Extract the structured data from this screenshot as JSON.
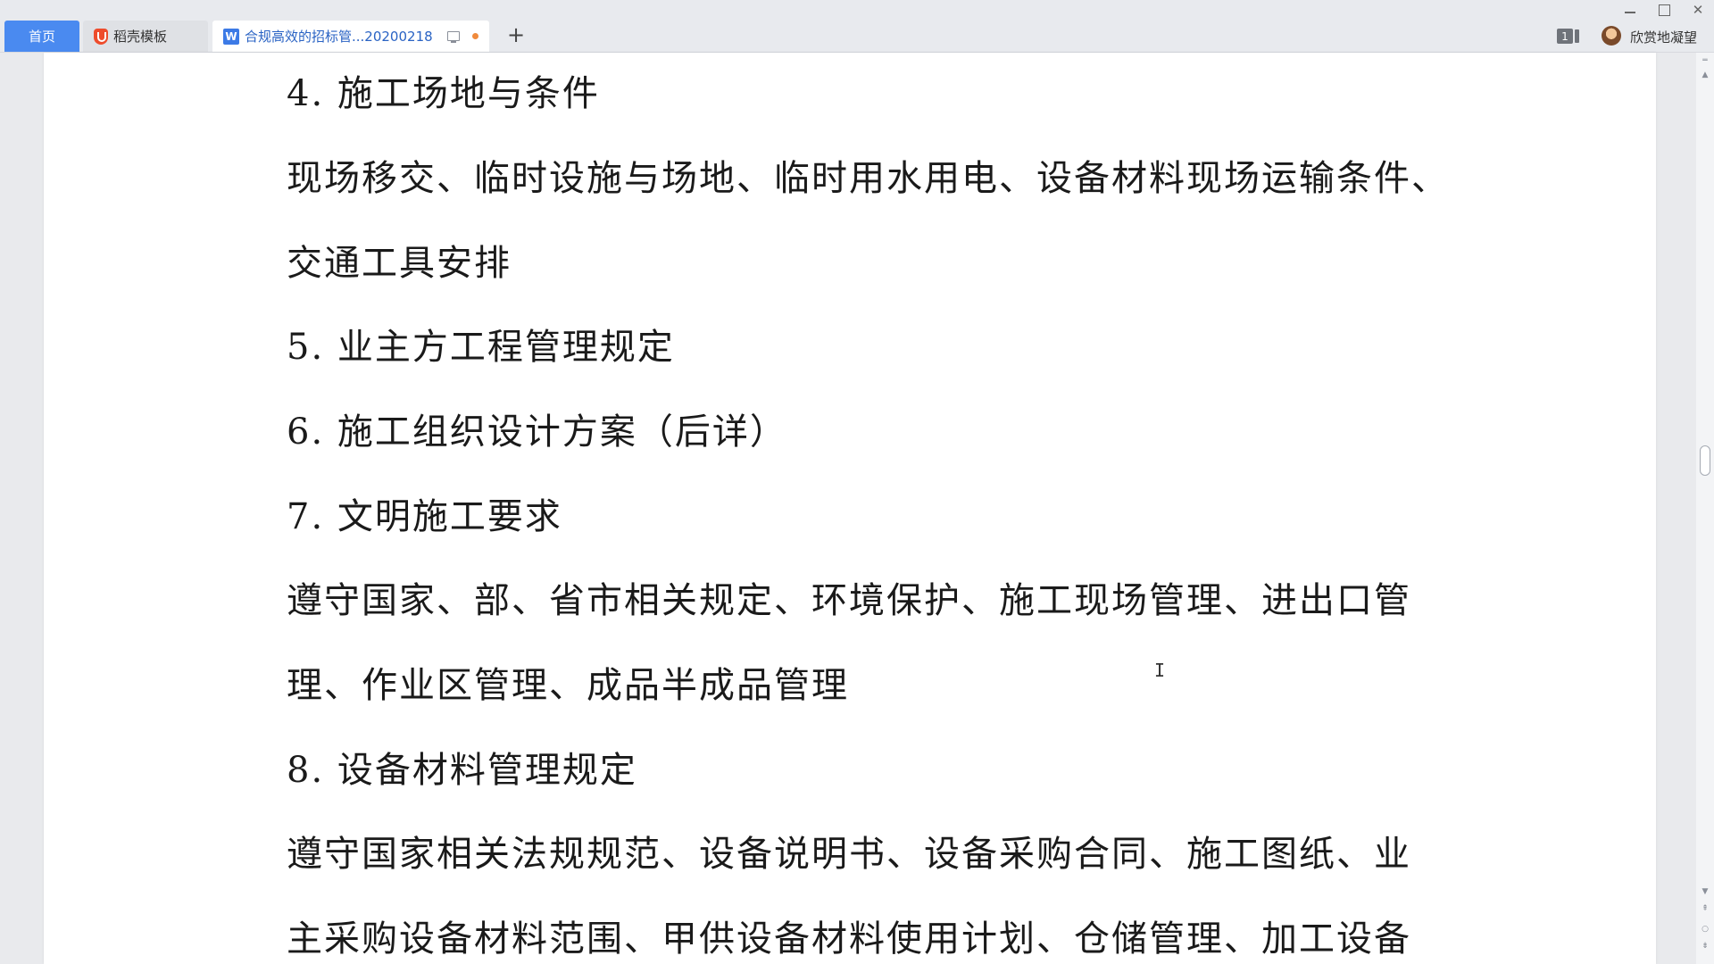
{
  "tabs": {
    "home_label": "首页",
    "template_label": "稻壳模板",
    "doc_label": "合规高效的招标管...20200218",
    "doc_icon_letter": "W",
    "new_tab_label": "+"
  },
  "header": {
    "badge_count": "1",
    "username": "欣赏地凝望"
  },
  "document": {
    "lines": [
      "4. 施工场地与条件",
      "现场移交、临时设施与场地、临时用水用电、设备材料现场运输条件、",
      "交通工具安排",
      "5. 业主方工程管理规定",
      "6. 施工组织设计方案（后详）",
      "7. 文明施工要求",
      "遵守国家、部、省市相关规定、环境保护、施工现场管理、进出口管",
      "理、作业区管理、成品半成品管理",
      "8. 设备材料管理规定",
      "遵守国家相关法规规范、设备说明书、设备采购合同、施工图纸、业",
      "主采购设备材料范围、甲供设备材料使用计划、仓储管理、加工设备"
    ]
  },
  "colors": {
    "accent": "#4a8af0",
    "unsaved": "#f08a3c"
  },
  "icons": {
    "template_logo": "daoke-logo-icon",
    "doc_logo": "wps-writer-icon",
    "screen": "screen-icon",
    "cursor": "i-beam-cursor-icon"
  }
}
